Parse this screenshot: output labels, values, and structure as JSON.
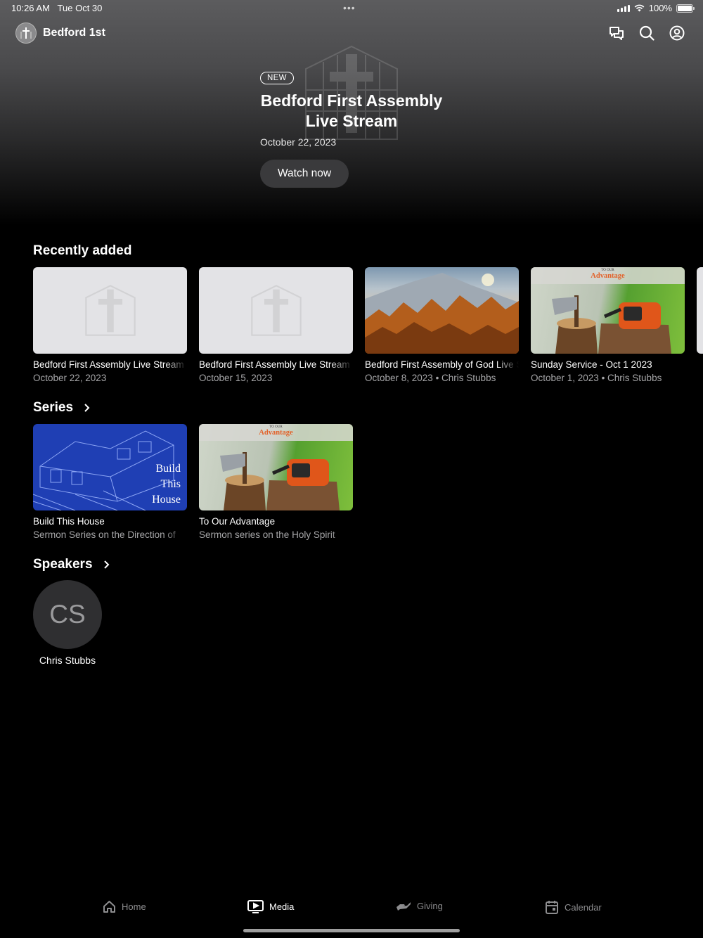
{
  "status_bar": {
    "time": "10:26 AM",
    "date": "Tue Oct 30",
    "battery": "100%"
  },
  "header": {
    "app_name": "Bedford 1st",
    "icons": [
      "chat-icon",
      "search-icon",
      "account-icon"
    ]
  },
  "hero": {
    "badge": "NEW",
    "title": "Bedford First Assembly Live Stream",
    "date": "October 22, 2023",
    "button": "Watch now"
  },
  "recently_added": {
    "title": "Recently added",
    "items": [
      {
        "title": "Bedford First Assembly Live Stream",
        "subtitle": "October 22, 2023"
      },
      {
        "title": "Bedford First Assembly Live Stream",
        "subtitle": "October 15, 2023"
      },
      {
        "title": "Bedford First Assembly of God Live Stream",
        "subtitle": "October 8, 2023 • Chris Stubbs"
      },
      {
        "title": "Sunday Service - Oct 1 2023",
        "subtitle": "October 1, 2023 • Chris Stubbs",
        "thumb_top": "TO OUR",
        "thumb_word": "Advantage"
      }
    ]
  },
  "series": {
    "title": "Series",
    "items": [
      {
        "title": "Build This House",
        "subtitle": "Sermon Series on the Direction of",
        "thumb_lines": [
          "Build",
          "This",
          "House"
        ]
      },
      {
        "title": "To Our Advantage",
        "subtitle": "Sermon series on the Holy Spirit",
        "thumb_top": "TO OUR",
        "thumb_word": "Advantage"
      }
    ]
  },
  "speakers": {
    "title": "Speakers",
    "items": [
      {
        "initials": "CS",
        "name": "Chris Stubbs"
      }
    ]
  },
  "tabs": {
    "home": "Home",
    "media": "Media",
    "giving": "Giving",
    "calendar": "Calendar",
    "active": "Media"
  }
}
